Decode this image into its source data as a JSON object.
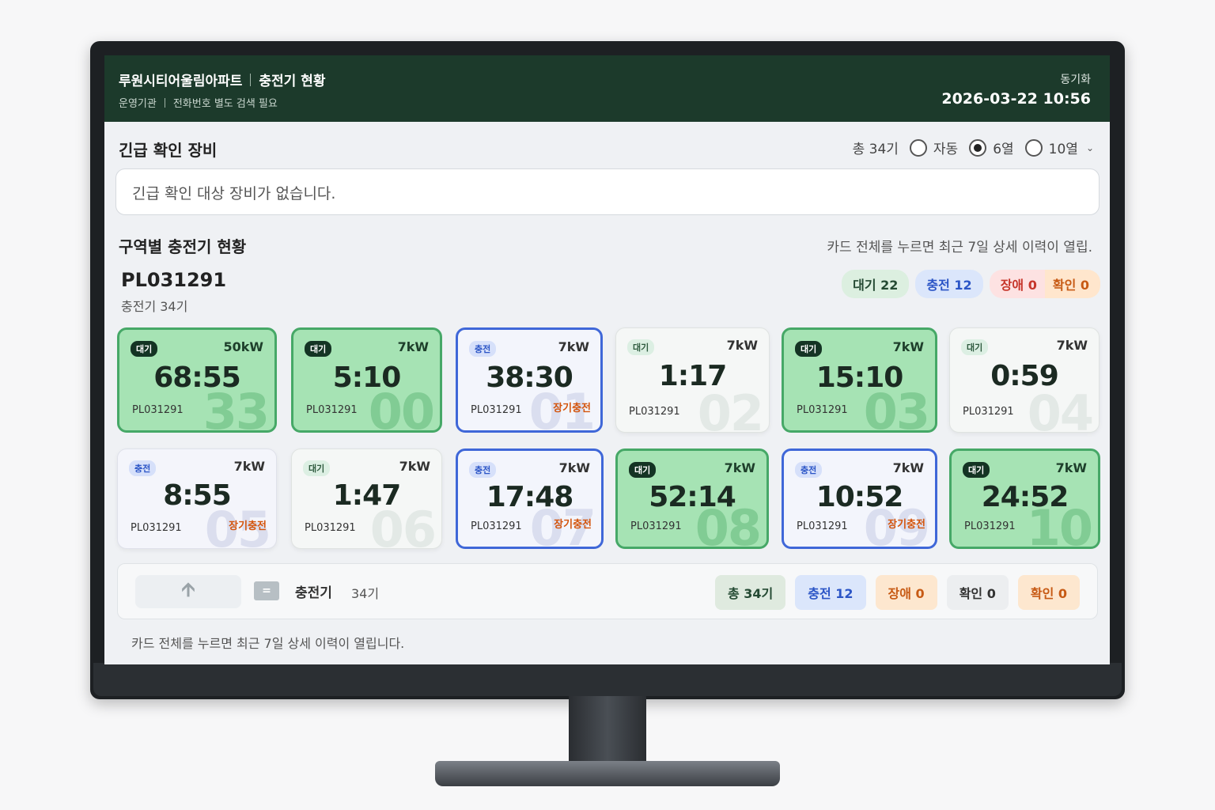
{
  "header": {
    "complex_name": "루원시티어울림아파트",
    "page_name": "충전기 현황",
    "operator_label": "운영기관",
    "phone_note": "전화번호 별도 검색 필요",
    "sync_label": "동기화",
    "sync_time": "2026-03-22 10:56"
  },
  "urgent": {
    "title": "긴급 확인 장비",
    "empty_message": "긴급 확인 대상 장비가 없습니다."
  },
  "view_controls": {
    "total": "총 34기",
    "options": [
      {
        "label": "자동",
        "selected": false
      },
      {
        "label": "6열",
        "selected": true
      },
      {
        "label": "10열",
        "selected": false
      }
    ]
  },
  "zone": {
    "title": "구역별 충전기 현황",
    "hint": "카드 전체를 누르면 최근 7일 상세 이력이 열립.",
    "site_id": "PL031291",
    "site_count": "충전기 34기",
    "summary": {
      "wait": "대기 22",
      "charge": "충전 12",
      "fault": "장애 0",
      "check": "확인 0"
    }
  },
  "chargers": [
    {
      "status": "대기",
      "power": "50kW",
      "time": "68:55",
      "id": "PL031291",
      "num": "33",
      "flag": ""
    },
    {
      "status": "대기",
      "power": "7kW",
      "time": "5:10",
      "id": "PL031291",
      "num": "00",
      "flag": ""
    },
    {
      "status": "충전",
      "power": "7kW",
      "time": "38:30",
      "id": "PL031291",
      "num": "01",
      "flag": "장기충전"
    },
    {
      "status": "대기",
      "power": "7kW",
      "time": "1:17",
      "id": "PL031291",
      "num": "02",
      "flag": ""
    },
    {
      "status": "대기",
      "power": "7kW",
      "time": "15:10",
      "id": "PL031291",
      "num": "03",
      "flag": ""
    },
    {
      "status": "대기",
      "power": "7kW",
      "time": "0:59",
      "id": "PL031291",
      "num": "04",
      "flag": ""
    },
    {
      "status": "충전",
      "power": "7kW",
      "time": "8:55",
      "id": "PL031291",
      "num": "05",
      "flag": "장기충전"
    },
    {
      "status": "대기",
      "power": "7kW",
      "time": "1:47",
      "id": "PL031291",
      "num": "06",
      "flag": ""
    },
    {
      "status": "충전",
      "power": "7kW",
      "time": "17:48",
      "id": "PL031291",
      "num": "07",
      "flag": "장기충전"
    },
    {
      "status": "대기",
      "power": "7kW",
      "time": "52:14",
      "id": "PL031291",
      "num": "08",
      "flag": ""
    },
    {
      "status": "충전",
      "power": "7kW",
      "time": "10:52",
      "id": "PL031291",
      "num": "09",
      "flag": "장기충전"
    },
    {
      "status": "대기",
      "power": "7kW",
      "time": "24:52",
      "id": "PL031291",
      "num": "10",
      "flag": ""
    }
  ],
  "bottom_bar": {
    "up_icon": "arrow-up-icon",
    "list_icon": "equals-icon",
    "list_icon_glyph": "=",
    "label": "충전기",
    "count": "34기",
    "total": "총 34기",
    "charge": "충전 12",
    "fault": "장애 0",
    "check_grey": "확인 0",
    "check_orange": "확인 0"
  },
  "footer_note": "카드 전체를 누르면 최근 7일 상세 이력이 열립니다.",
  "colors": {
    "header_bg": "#1c3a2b",
    "idle_highlight": "#a6e3b4",
    "charging_border": "#3f67d8",
    "long_charge": "#d4550d"
  }
}
